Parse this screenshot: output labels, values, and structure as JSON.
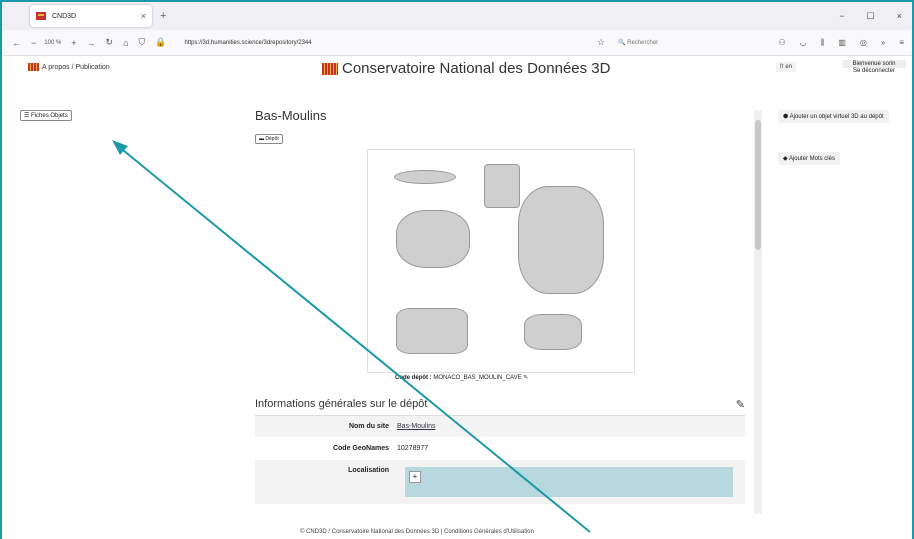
{
  "browser": {
    "tab_title": "CND3D",
    "zoom": "100 %",
    "url": "https://3d.humanities.science/3drepository/2344",
    "search_placeholder": "Rechercher"
  },
  "header": {
    "apropos": "A propos / Publication",
    "site_title": "Conservatoire National des Données 3D",
    "lang": "fr  en",
    "welcome": "Bienvenue sorin",
    "logout": "Se déconnecter"
  },
  "sidebar": {
    "fiches": "Fiches Objets"
  },
  "main": {
    "title": "Bas-Moulins",
    "depot_button": "Dépôt",
    "code_depot_label": "Code dépôt :",
    "code_depot_value": "MONACO_BAS_MOULIN_CAVE",
    "info_title": "Informations générales sur le dépôt",
    "rows": [
      {
        "k": "Nom du site",
        "v": "Bas-Moulins"
      },
      {
        "k": "Code GeoNames",
        "v": "10278977"
      },
      {
        "k": "Localisation",
        "v": ""
      }
    ]
  },
  "right": {
    "add_object": "Ajouter un objet virtuel 3D au dépôt",
    "add_tags": "Ajouter Mots clés"
  },
  "footer": {
    "text": "© CND3D / Conservatoire National des Données 3D | Conditions Générales d'Utilisation"
  }
}
